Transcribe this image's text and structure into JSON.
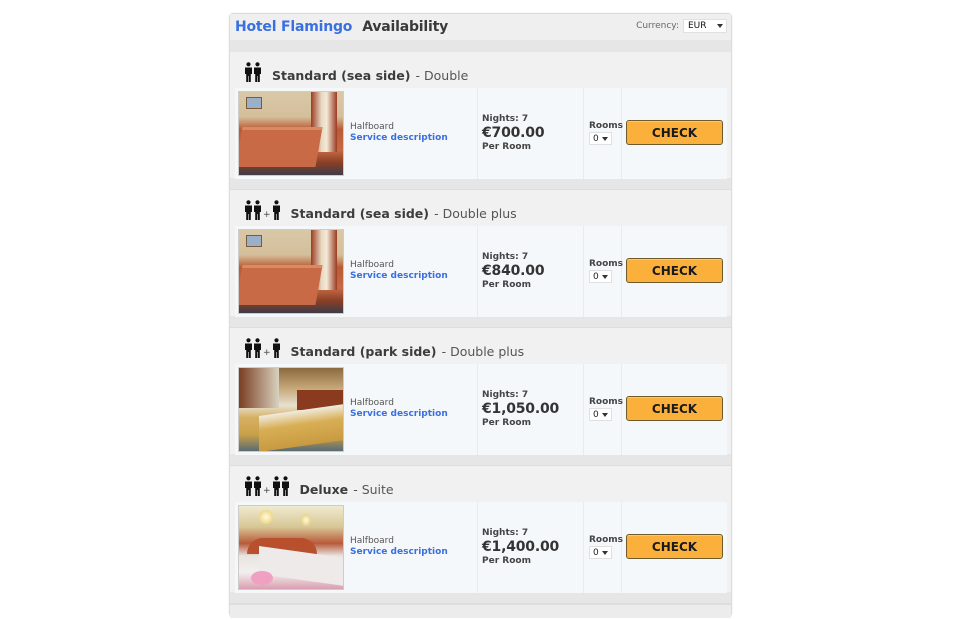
{
  "header": {
    "hotel_name": "Hotel Flamingo",
    "title": "Availability",
    "currency_label": "Currency:",
    "currency_value": "EUR"
  },
  "rooms": [
    {
      "name": "Standard (sea side)",
      "type": "- Double",
      "occupancy": {
        "adults": 2,
        "extra": 0
      },
      "board": "Halfboard",
      "service_link": "Service description",
      "nights": "Nights: 7",
      "price": "€700.00",
      "per": "Per Room",
      "rooms_label": "Rooms",
      "rooms_value": "0",
      "check_label": "CHECK",
      "photo": "bedroom-orange"
    },
    {
      "name": "Standard (sea side)",
      "type": "- Double plus",
      "occupancy": {
        "adults": 2,
        "extra": 1
      },
      "board": "Halfboard",
      "service_link": "Service description",
      "nights": "Nights: 7",
      "price": "€840.00",
      "per": "Per Room",
      "rooms_label": "Rooms",
      "rooms_value": "0",
      "check_label": "CHECK",
      "photo": "bedroom-orange"
    },
    {
      "name": "Standard (park side)",
      "type": "- Double plus",
      "occupancy": {
        "adults": 2,
        "extra": 1
      },
      "board": "Halfboard",
      "service_link": "Service description",
      "nights": "Nights: 7",
      "price": "€1,050.00",
      "per": "Per Room",
      "rooms_label": "Rooms",
      "rooms_value": "0",
      "check_label": "CHECK",
      "photo": "bedroom-twin-gold"
    },
    {
      "name": "Deluxe",
      "type": "- Suite",
      "occupancy": {
        "adults": 2,
        "extra": 2
      },
      "board": "Halfboard",
      "service_link": "Service description",
      "nights": "Nights: 7",
      "price": "€1,400.00",
      "per": "Per Room",
      "rooms_label": "Rooms",
      "rooms_value": "0",
      "check_label": "CHECK",
      "photo": "suite-glasses"
    }
  ],
  "icons": {
    "person": "person-icon",
    "plus": "+",
    "dropdown": "caret-down-icon"
  },
  "colors": {
    "brand_blue": "#3a6fe0",
    "check_button": "#fbb03b"
  }
}
